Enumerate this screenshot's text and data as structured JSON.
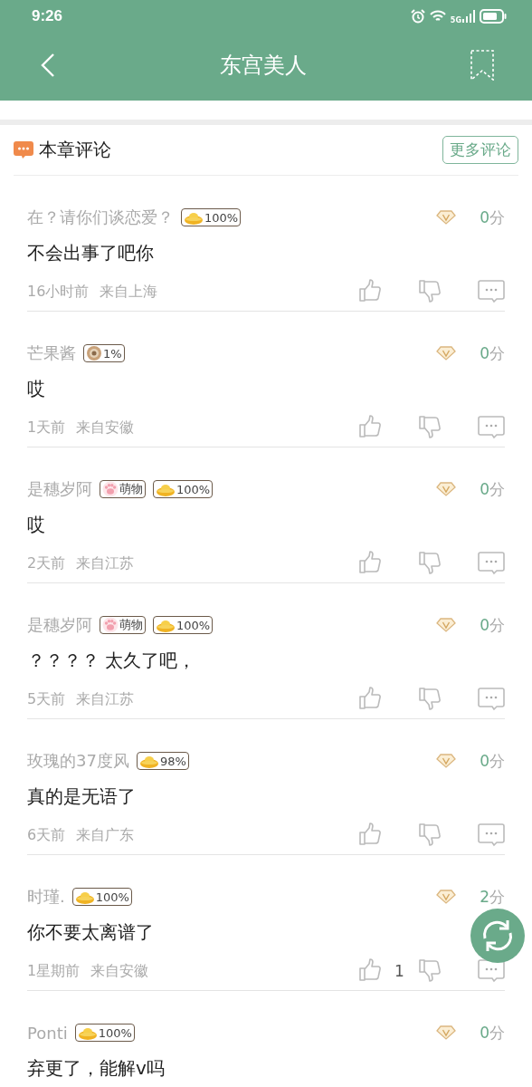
{
  "status_bar": {
    "time": "9:26",
    "network": "5G"
  },
  "nav": {
    "title": "东宫美人"
  },
  "section": {
    "title": "本章评论",
    "more_button": "更多评论"
  },
  "comments": [
    {
      "user": "在？请你们谈恋爱？",
      "badges": [
        {
          "kind": "gold",
          "text": "100%"
        }
      ],
      "score": "0",
      "score_unit": "分",
      "text": "不会出事了吧你",
      "time": "16小时前",
      "location": "来自上海"
    },
    {
      "user": "芒果酱",
      "badges": [
        {
          "kind": "coin",
          "text": "1%"
        }
      ],
      "score": "0",
      "score_unit": "分",
      "text": "哎",
      "time": "1天前",
      "location": "来自安徽"
    },
    {
      "user": "是穗岁阿",
      "badges": [
        {
          "kind": "paw",
          "text": "萌物"
        },
        {
          "kind": "gold",
          "text": "100%"
        }
      ],
      "score": "0",
      "score_unit": "分",
      "text": "哎",
      "time": "2天前",
      "location": "来自江苏"
    },
    {
      "user": "是穗岁阿",
      "badges": [
        {
          "kind": "paw",
          "text": "萌物"
        },
        {
          "kind": "gold",
          "text": "100%"
        }
      ],
      "score": "0",
      "score_unit": "分",
      "text": "？？？？ 太久了吧，",
      "time": "5天前",
      "location": "来自江苏"
    },
    {
      "user": "玫瑰的37度风",
      "badges": [
        {
          "kind": "gold",
          "text": "98%"
        }
      ],
      "score": "0",
      "score_unit": "分",
      "text": "真的是无语了",
      "time": "6天前",
      "location": "来自广东"
    },
    {
      "user": "时瑾.",
      "badges": [
        {
          "kind": "gold",
          "text": "100%"
        }
      ],
      "score": "2",
      "score_unit": "分",
      "text": "你不要太离谱了",
      "time": "1星期前",
      "location": "来自安徽",
      "likes": "1"
    },
    {
      "user": "Ponti",
      "badges": [
        {
          "kind": "gold",
          "text": "100%"
        }
      ],
      "score": "0",
      "score_unit": "分",
      "text": "弃更了，能解v吗"
    }
  ]
}
